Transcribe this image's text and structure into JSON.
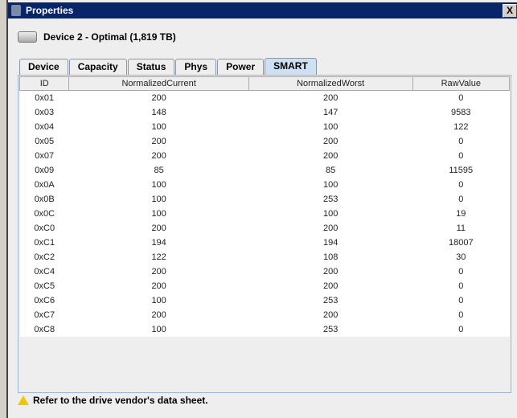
{
  "window": {
    "title": "Properties",
    "close": "X"
  },
  "device": {
    "label": "Device 2 - Optimal (1,819 TB)"
  },
  "tabs": [
    "Device",
    "Capacity",
    "Status",
    "Phys",
    "Power",
    "SMART"
  ],
  "active_tab": "SMART",
  "table": {
    "columns": [
      "ID",
      "NormalizedCurrent",
      "NormalizedWorst",
      "RawValue"
    ],
    "rows": [
      [
        "0x01",
        "200",
        "200",
        "0"
      ],
      [
        "0x03",
        "148",
        "147",
        "9583"
      ],
      [
        "0x04",
        "100",
        "100",
        "122"
      ],
      [
        "0x05",
        "200",
        "200",
        "0"
      ],
      [
        "0x07",
        "200",
        "200",
        "0"
      ],
      [
        "0x09",
        "85",
        "85",
        "11595"
      ],
      [
        "0x0A",
        "100",
        "100",
        "0"
      ],
      [
        "0x0B",
        "100",
        "253",
        "0"
      ],
      [
        "0x0C",
        "100",
        "100",
        "19"
      ],
      [
        "0xC0",
        "200",
        "200",
        "11"
      ],
      [
        "0xC1",
        "194",
        "194",
        "18007"
      ],
      [
        "0xC2",
        "122",
        "108",
        "30"
      ],
      [
        "0xC4",
        "200",
        "200",
        "0"
      ],
      [
        "0xC5",
        "200",
        "200",
        "0"
      ],
      [
        "0xC6",
        "100",
        "253",
        "0"
      ],
      [
        "0xC7",
        "200",
        "200",
        "0"
      ],
      [
        "0xC8",
        "100",
        "253",
        "0"
      ]
    ]
  },
  "footer": {
    "note": "Refer to the drive vendor's data sheet.",
    "icon": "warning-icon"
  }
}
